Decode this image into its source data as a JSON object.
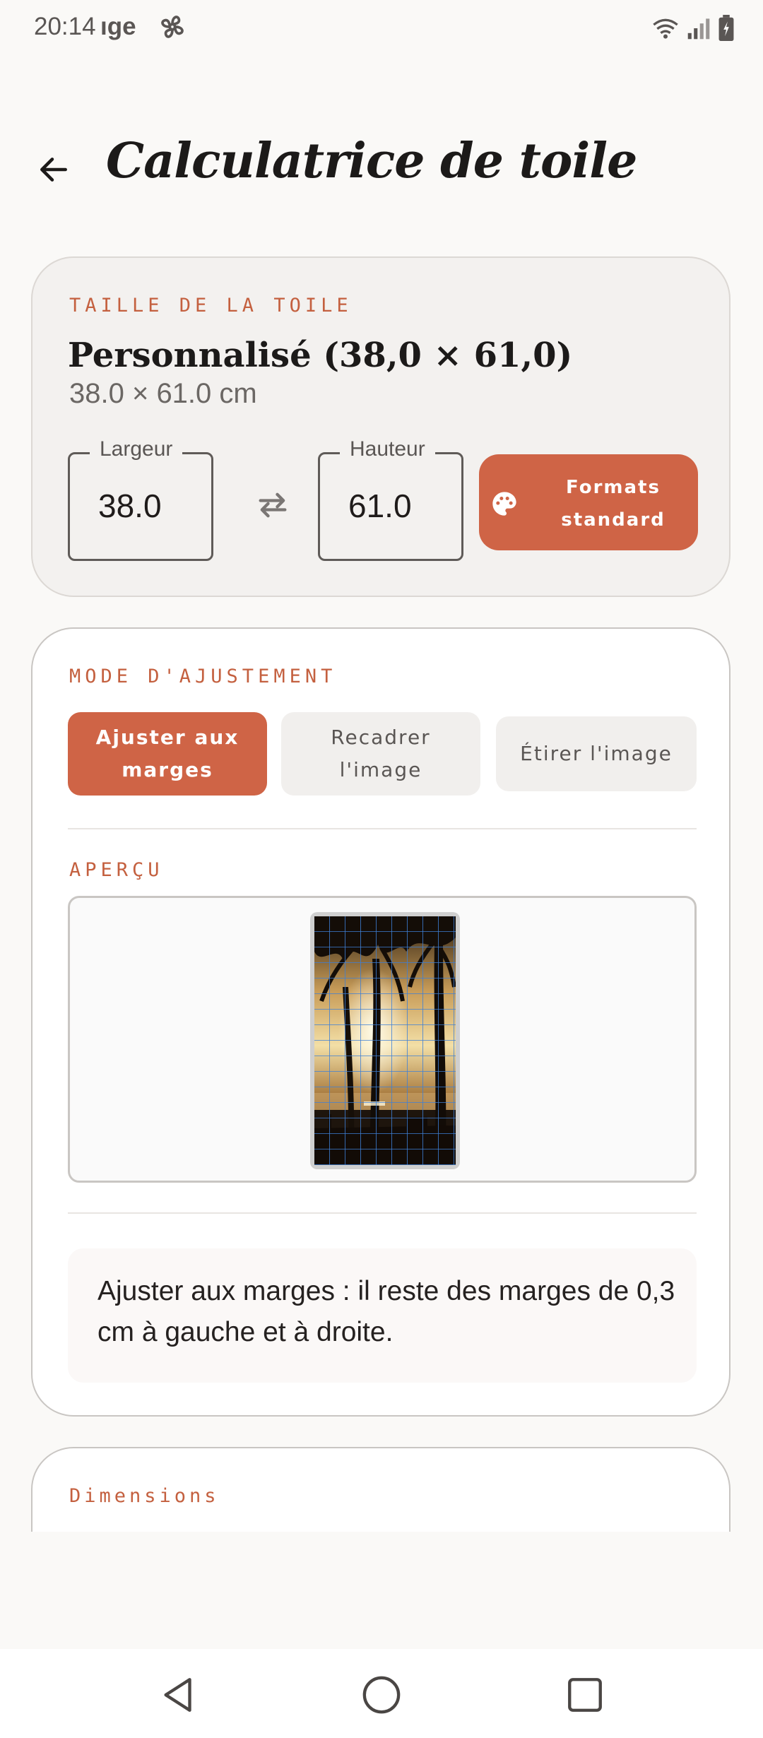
{
  "status": {
    "time": "20:14",
    "carrier": "ıge",
    "icons": [
      "fan-icon",
      "wifi-icon",
      "signal-icon",
      "battery-icon"
    ]
  },
  "appbar": {
    "back_icon": "arrow-left-icon",
    "title": "Calculatrice de toile"
  },
  "canvas_size": {
    "section_label": "TAILLE DE LA TOILE",
    "name": "Personnalisé (38,0 × 61,0)",
    "dimensions": "38.0 × 61.0 cm",
    "width_label": "Largeur",
    "width_value": "38.0",
    "height_label": "Hauteur",
    "height_value": "61.0",
    "swap_icon": "swap-horizontal-icon",
    "formats_line1": "Formats",
    "formats_line2": "standard",
    "formats_icon": "palette-icon"
  },
  "fit_mode": {
    "section_label": "MODE D'AJUSTEMENT",
    "options": [
      {
        "line1": "Ajuster aux",
        "line2": "marges",
        "active": true
      },
      {
        "line1": "Recadrer",
        "line2": "l'image",
        "active": false
      },
      {
        "line1": "Étirer l'image",
        "line2": "",
        "active": false
      }
    ],
    "preview_label": "APERÇU",
    "info": "Ajuster aux marges : il reste des marges de 0,3 cm à gauche et à droite."
  },
  "dimensions_card": {
    "section_label": "Dimensions"
  },
  "navbar": {
    "icons": [
      "nav-back-icon",
      "nav-home-icon",
      "nav-recents-icon"
    ]
  },
  "colors": {
    "accent": "#cf6446",
    "label": "#c4603f",
    "background": "#faf9f7"
  }
}
